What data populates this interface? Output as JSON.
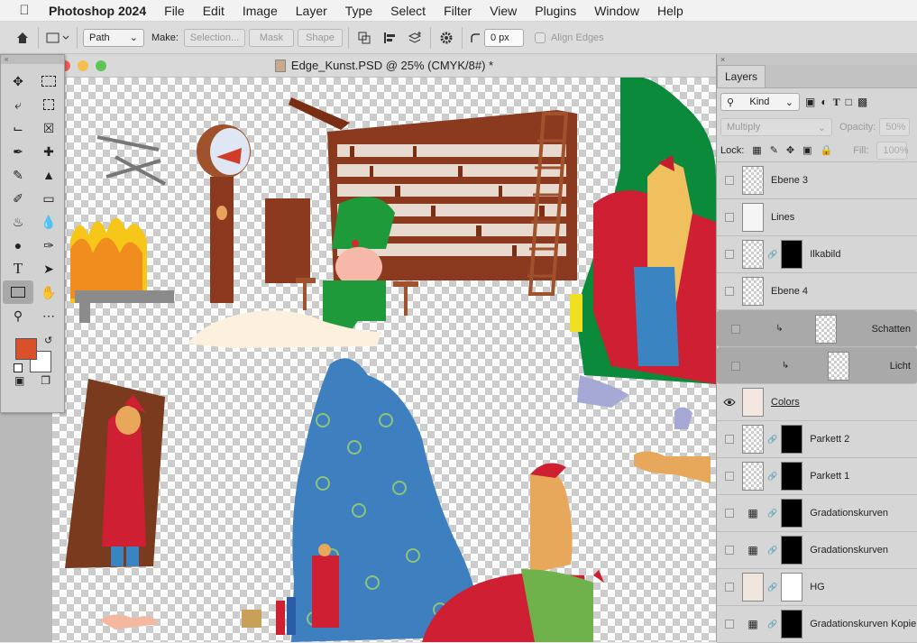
{
  "menubar": {
    "app_name": "Photoshop 2024",
    "items": [
      "File",
      "Edit",
      "Image",
      "Layer",
      "Type",
      "Select",
      "Filter",
      "View",
      "Plugins",
      "Window",
      "Help"
    ]
  },
  "options_bar": {
    "mode_select": "Path",
    "make_label": "Make:",
    "selection_button": "Selection...",
    "mask_button": "Mask",
    "shape_button": "Shape",
    "radius_value": "0 px",
    "align_edges_label": "Align Edges"
  },
  "document": {
    "title": "Edge_Kunst.PSD @ 25% (CMYK/8#) *"
  },
  "colors": {
    "foreground": "#d9512a",
    "background": "#ffffff"
  },
  "layers_panel": {
    "tab_label": "Layers",
    "filter_kind": "Kind",
    "blend_mode": "Multiply",
    "opacity_label": "Opacity:",
    "opacity_value": "50%",
    "lock_label": "Lock:",
    "fill_label": "Fill:",
    "fill_value": "100%",
    "layers": [
      {
        "name": "Ebene 3",
        "visible": false,
        "has_mask": false,
        "selected": false,
        "clipped": false
      },
      {
        "name": "Lines",
        "visible": false,
        "has_mask": false,
        "selected": false,
        "clipped": false
      },
      {
        "name": "Ilkabild",
        "visible": false,
        "has_mask": true,
        "selected": false,
        "clipped": false
      },
      {
        "name": "Ebene 4",
        "visible": false,
        "has_mask": false,
        "selected": false,
        "clipped": false
      },
      {
        "name": "Schatten",
        "visible": false,
        "has_mask": false,
        "selected": true,
        "clipped": true
      },
      {
        "name": "Licht",
        "visible": false,
        "has_mask": false,
        "selected": true,
        "clipped": true
      },
      {
        "name": "Colors",
        "visible": true,
        "has_mask": false,
        "selected": false,
        "clipped": false
      },
      {
        "name": "Parkett 2",
        "visible": false,
        "has_mask": true,
        "selected": false,
        "clipped": false
      },
      {
        "name": "Parkett 1",
        "visible": false,
        "has_mask": true,
        "selected": false,
        "clipped": false
      },
      {
        "name": "Gradationskurven",
        "visible": false,
        "has_mask": true,
        "selected": false,
        "clipped": false
      },
      {
        "name": "Gradationskurven",
        "visible": false,
        "has_mask": true,
        "selected": false,
        "clipped": false
      },
      {
        "name": "HG",
        "visible": false,
        "has_mask": true,
        "selected": false,
        "clipped": false
      },
      {
        "name": "Gradationskurven Kopie",
        "visible": false,
        "has_mask": true,
        "selected": false,
        "clipped": false
      }
    ]
  }
}
